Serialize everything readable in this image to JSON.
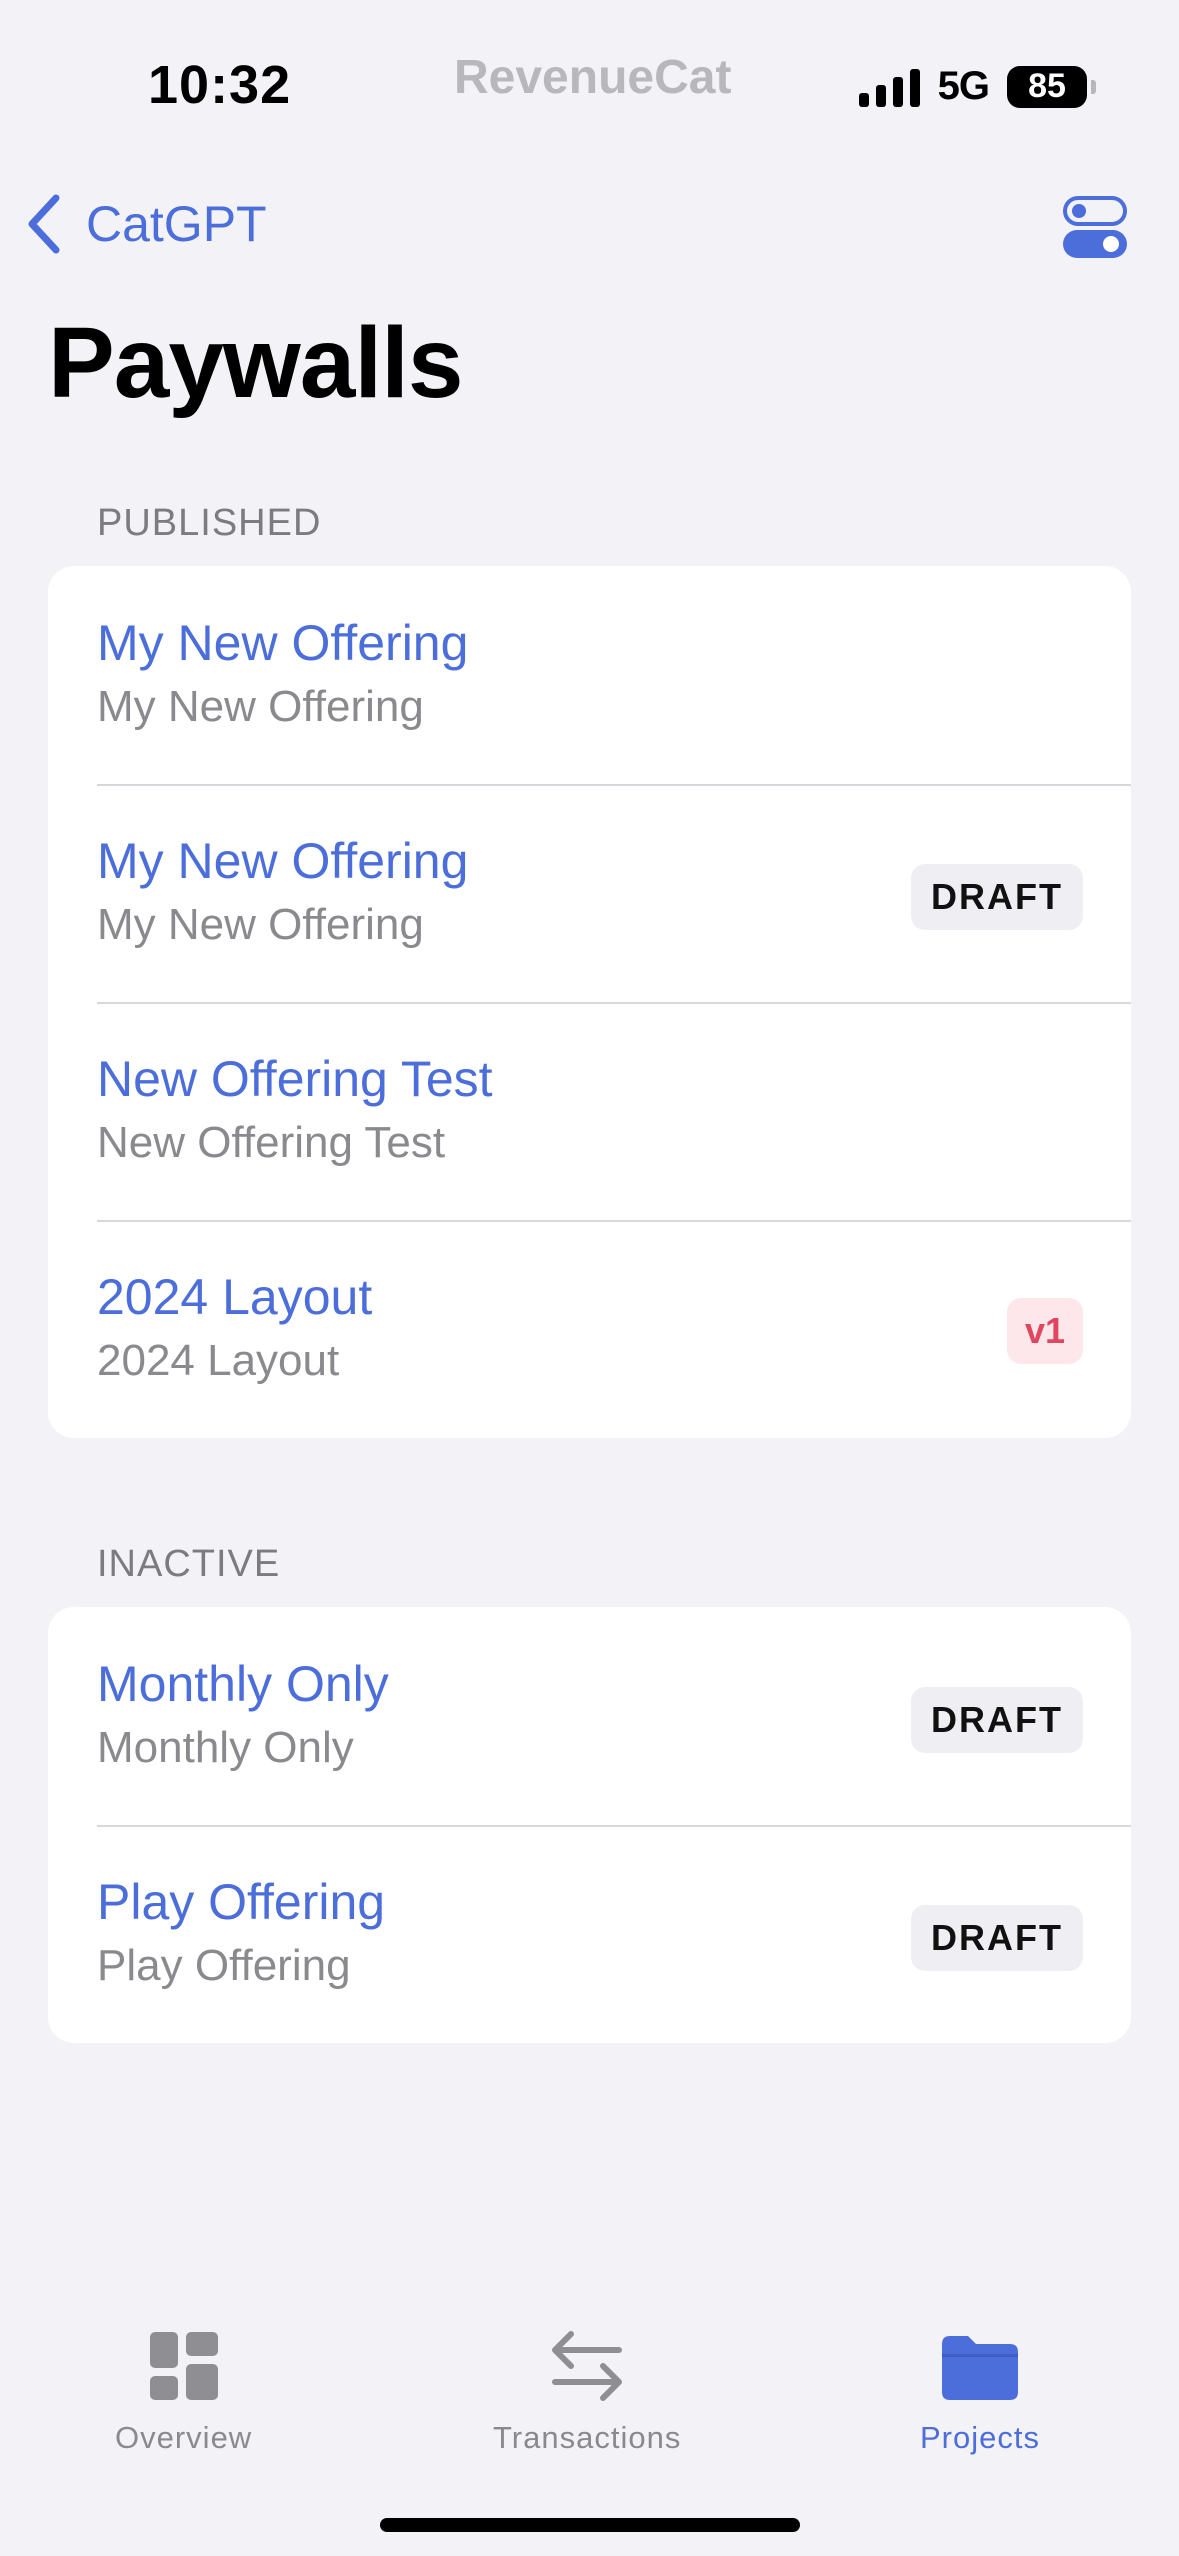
{
  "status": {
    "time": "10:32",
    "brand": "RevenueCat",
    "network": "5G",
    "battery": "85"
  },
  "nav": {
    "back_label": "CatGPT",
    "title": "Paywalls"
  },
  "sections": {
    "published": {
      "header": "PUBLISHED",
      "rows": [
        {
          "title": "My New Offering",
          "subtitle": "My New Offering",
          "badge": ""
        },
        {
          "title": "My New Offering",
          "subtitle": "My New Offering",
          "badge": "DRAFT"
        },
        {
          "title": "New Offering Test",
          "subtitle": "New Offering Test",
          "badge": ""
        },
        {
          "title": "2024 Layout",
          "subtitle": "2024 Layout",
          "badge": "v1"
        }
      ]
    },
    "inactive": {
      "header": "INACTIVE",
      "rows": [
        {
          "title": "Monthly Only",
          "subtitle": "Monthly Only",
          "badge": "DRAFT"
        },
        {
          "title": "Play Offering",
          "subtitle": "Play Offering",
          "badge": "DRAFT"
        }
      ]
    }
  },
  "tabs": [
    {
      "label": "Overview",
      "icon": "grid-icon"
    },
    {
      "label": "Transactions",
      "icon": "arrows-icon"
    },
    {
      "label": "Projects",
      "icon": "folder-icon",
      "active": true
    }
  ],
  "colors": {
    "accent": "#4C6EDB",
    "background": "#F2F2F7",
    "secondary_text": "#8A8A8E",
    "v1_badge": "#E0475E"
  }
}
